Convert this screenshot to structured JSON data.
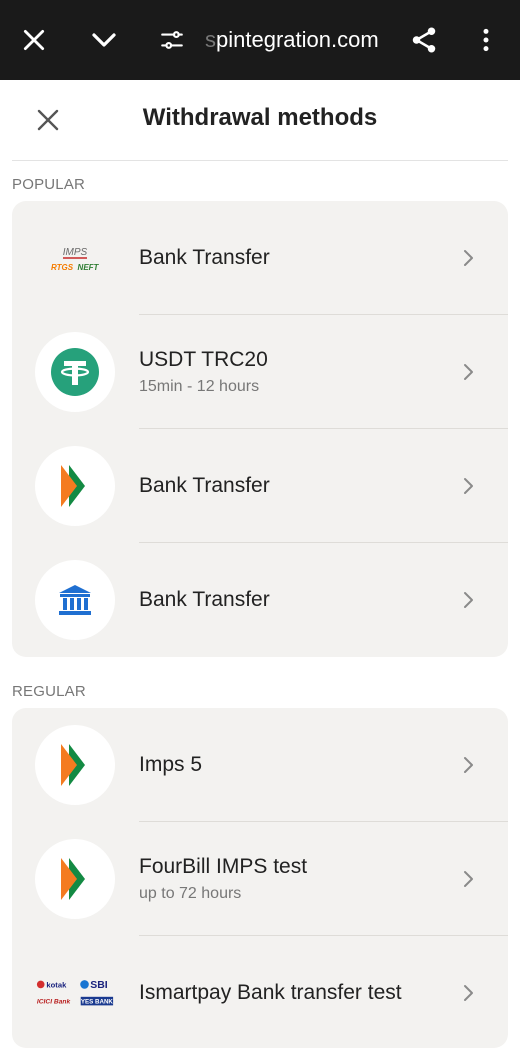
{
  "browser": {
    "url_prefix_faded": "s",
    "url_rest": "pintegration.com",
    "icons": [
      "close-icon",
      "chevron-down-icon",
      "tune-icon",
      "share-icon",
      "more-vert-icon"
    ]
  },
  "header": {
    "title": "Withdrawal methods"
  },
  "sections": {
    "popular": {
      "label": "POPULAR",
      "items": [
        {
          "name": "Bank Transfer",
          "sub": "",
          "icon": "imps-rtgs-neft-logo"
        },
        {
          "name": "USDT TRC20",
          "sub": "15min - 12 hours",
          "icon": "tether-icon"
        },
        {
          "name": "Bank Transfer",
          "sub": "",
          "icon": "bhim-icon"
        },
        {
          "name": "Bank Transfer",
          "sub": "",
          "icon": "bank-building-icon"
        }
      ]
    },
    "regular": {
      "label": "REGULAR",
      "items": [
        {
          "name": "Imps 5",
          "sub": "",
          "icon": "bhim-icon"
        },
        {
          "name": "FourBill IMPS test",
          "sub": "up to 72 hours",
          "icon": "bhim-icon"
        },
        {
          "name": "Ismartpay Bank transfer test",
          "sub": "",
          "icon": "bank-logos-icon"
        }
      ]
    }
  },
  "logos": {
    "imps": "IMPS",
    "rtgs": "RTGS",
    "neft": "NEFT",
    "kotak": "kotak",
    "sbi": "SBI",
    "icici": "ICICI Bank",
    "yes": "YES BANK"
  },
  "colors": {
    "topbar": "#1a1a1a",
    "card": "#f3f2f0",
    "tether": "#26a17b",
    "bank_blue": "#1f6fd1",
    "bhim_orange": "#f47b20",
    "bhim_green": "#138a43"
  }
}
